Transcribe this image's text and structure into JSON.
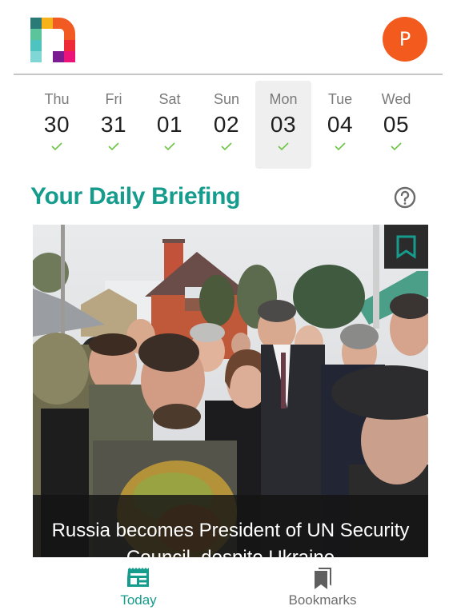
{
  "header": {
    "logo_alt": "app-logo",
    "avatar_initial": "P",
    "avatar_color": "#f35a1d"
  },
  "date_strip": {
    "days": [
      {
        "dow": "Thu",
        "date": "30",
        "completed": true,
        "selected": false
      },
      {
        "dow": "Fri",
        "date": "31",
        "completed": true,
        "selected": false
      },
      {
        "dow": "Sat",
        "date": "01",
        "completed": true,
        "selected": false
      },
      {
        "dow": "Sun",
        "date": "02",
        "completed": true,
        "selected": false
      },
      {
        "dow": "Mon",
        "date": "03",
        "completed": true,
        "selected": true
      },
      {
        "dow": "Tue",
        "date": "04",
        "completed": true,
        "selected": false
      },
      {
        "dow": "Wed",
        "date": "05",
        "completed": true,
        "selected": false
      }
    ],
    "check_color": "#6cc644"
  },
  "briefing": {
    "title": "Your Daily Briefing",
    "help_icon": "question-circle-icon",
    "accent_color": "#159c8c"
  },
  "story": {
    "headline": "Russia becomes President of UN Security Council, despite Ukraine",
    "image_description": "Crowd of officials and soldiers in front of a brick house",
    "bookmark_icon": "bookmark-outline-icon"
  },
  "bottom_nav": {
    "items": [
      {
        "label": "Today",
        "icon": "newspaper-icon",
        "active": true
      },
      {
        "label": "Bookmarks",
        "icon": "bookmarks-icon",
        "active": false
      }
    ]
  }
}
